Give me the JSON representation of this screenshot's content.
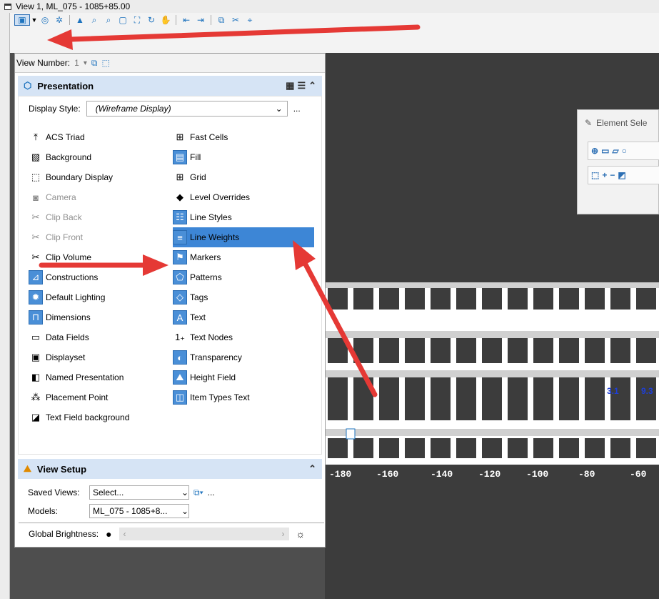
{
  "window": {
    "title": "View 1, ML_075 - 1085+85.00"
  },
  "view_number": {
    "label": "View Number:",
    "value": "1"
  },
  "presentation": {
    "title": "Presentation",
    "display_style_label": "Display Style:",
    "display_style_value": "(Wireframe Display)",
    "more": "...",
    "left_items": [
      {
        "label": "ACS Triad",
        "icon": "acs-triad-icon",
        "on": false,
        "dim": false
      },
      {
        "label": "Background",
        "icon": "background-icon",
        "on": false,
        "dim": false
      },
      {
        "label": "Boundary Display",
        "icon": "boundary-display-icon",
        "on": false,
        "dim": false
      },
      {
        "label": "Camera",
        "icon": "camera-icon",
        "on": false,
        "dim": true
      },
      {
        "label": "Clip Back",
        "icon": "clip-back-icon",
        "on": false,
        "dim": true
      },
      {
        "label": "Clip Front",
        "icon": "clip-front-icon",
        "on": false,
        "dim": true
      },
      {
        "label": "Clip Volume",
        "icon": "clip-volume-icon",
        "on": false,
        "dim": false
      },
      {
        "label": "Constructions",
        "icon": "constructions-icon",
        "on": true,
        "dim": false
      },
      {
        "label": "Default Lighting",
        "icon": "default-lighting-icon",
        "on": true,
        "dim": false
      },
      {
        "label": "Dimensions",
        "icon": "dimensions-icon",
        "on": true,
        "dim": false
      },
      {
        "label": "Data Fields",
        "icon": "data-fields-icon",
        "on": false,
        "dim": false
      },
      {
        "label": "Displayset",
        "icon": "displayset-icon",
        "on": false,
        "dim": false
      },
      {
        "label": "Named Presentation",
        "icon": "named-presentation-icon",
        "on": false,
        "dim": false
      },
      {
        "label": "Placement Point",
        "icon": "placement-point-icon",
        "on": false,
        "dim": false
      },
      {
        "label": "Text Field background",
        "icon": "text-field-background-icon",
        "on": false,
        "dim": false
      }
    ],
    "right_items": [
      {
        "label": "Fast Cells",
        "icon": "fast-cells-icon",
        "on": false
      },
      {
        "label": "Fill",
        "icon": "fill-icon",
        "on": true
      },
      {
        "label": "Grid",
        "icon": "grid-icon",
        "on": false
      },
      {
        "label": "Level Overrides",
        "icon": "level-overrides-icon",
        "on": false
      },
      {
        "label": "Line Styles",
        "icon": "line-styles-icon",
        "on": true
      },
      {
        "label": "Line Weights",
        "icon": "line-weights-icon",
        "on": true,
        "selected": true
      },
      {
        "label": "Markers",
        "icon": "markers-icon",
        "on": true
      },
      {
        "label": "Patterns",
        "icon": "patterns-icon",
        "on": true
      },
      {
        "label": "Tags",
        "icon": "tags-icon",
        "on": true
      },
      {
        "label": "Text",
        "icon": "text-icon",
        "on": true
      },
      {
        "label": "Text Nodes",
        "icon": "text-nodes-icon",
        "on": false
      },
      {
        "label": "Transparency",
        "icon": "transparency-icon",
        "on": true
      },
      {
        "label": "Height Field",
        "icon": "height-field-icon",
        "on": true
      },
      {
        "label": "Item Types Text",
        "icon": "item-types-text-icon",
        "on": true
      }
    ],
    "brightness_label": "Global Brightness:"
  },
  "view_setup": {
    "title": "View Setup",
    "saved_views_label": "Saved Views:",
    "saved_views_value": "Select...",
    "models_label": "Models:",
    "models_value": "ML_075 - 1085+8...",
    "more": "..."
  },
  "element_selection": {
    "title": "Element Sele"
  },
  "axis": {
    "ticks": [
      "-180",
      "-160",
      "-140",
      "-120",
      "-100",
      "-80",
      "-60"
    ]
  },
  "annotations": {
    "a": "3.1",
    "b": "9.3"
  },
  "colors": {
    "accent": "#3d86d6",
    "arrow": "#e53935",
    "header": "#d6e4f5"
  }
}
